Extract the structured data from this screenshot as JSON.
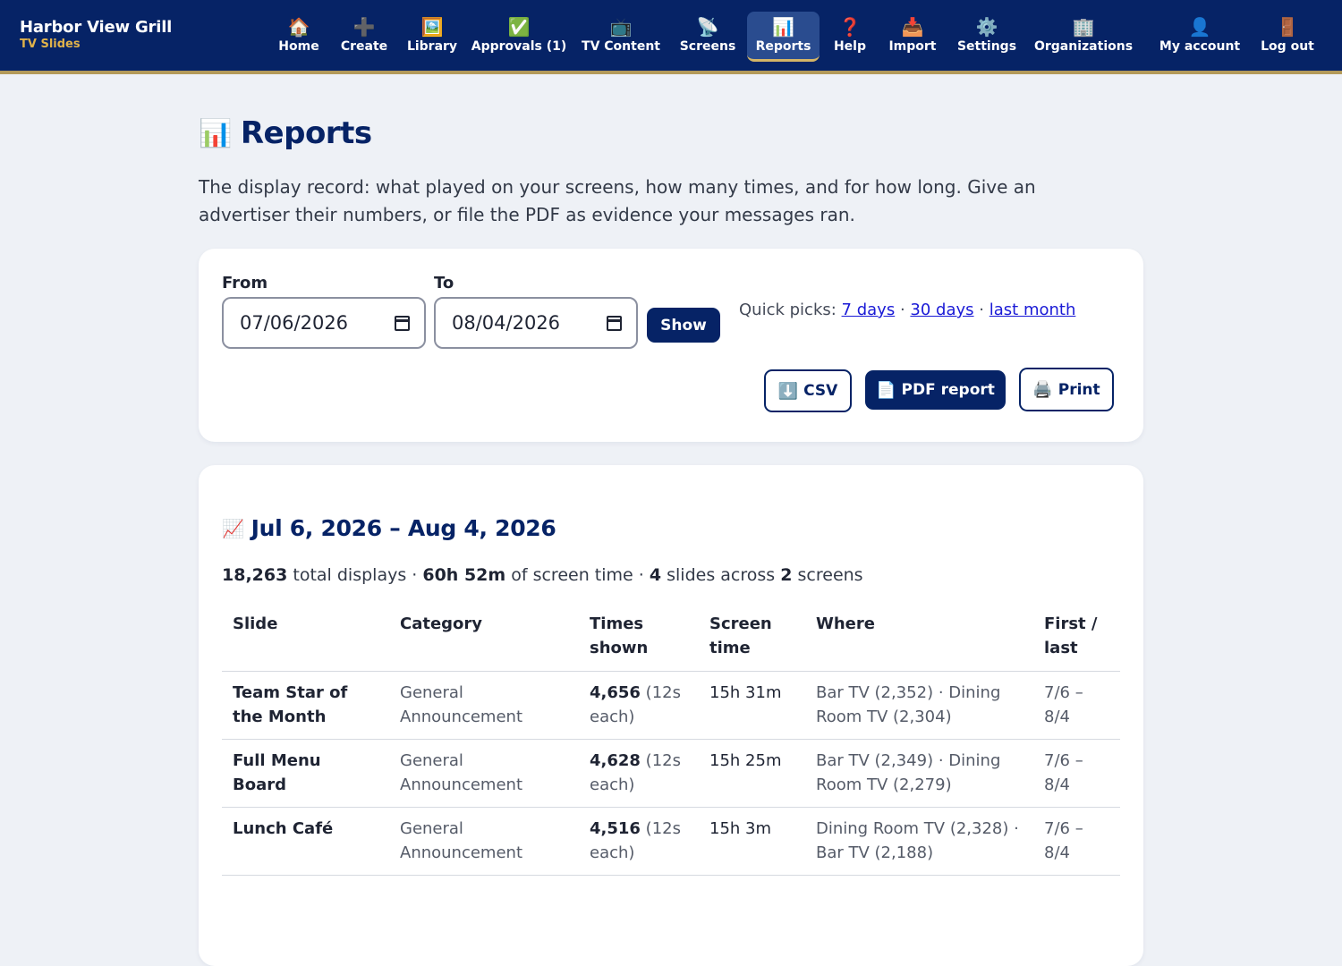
{
  "brand": {
    "title": "Harbor View Grill",
    "subtitle": "TV Slides"
  },
  "nav": [
    {
      "label": "Home",
      "icon": "🏠"
    },
    {
      "label": "Create",
      "icon": "➕"
    },
    {
      "label": "Library",
      "icon": "🖼️"
    },
    {
      "label": "Approvals (1)",
      "icon": "✅"
    },
    {
      "label": "TV Content",
      "icon": "📺"
    },
    {
      "label": "Screens",
      "icon": "📡"
    },
    {
      "label": "Reports",
      "icon": "📊"
    },
    {
      "label": "Help",
      "icon": "❓"
    },
    {
      "label": "Import",
      "icon": "📥"
    },
    {
      "label": "Settings",
      "icon": "⚙️"
    },
    {
      "label": "Organizations",
      "icon": "🏢"
    },
    {
      "label": "My account",
      "icon": "👤"
    },
    {
      "label": "Log out",
      "icon": "🚪"
    }
  ],
  "active_nav": "Reports",
  "page": {
    "title": "Reports",
    "title_icon": "📊",
    "intro": "The display record: what played on your screens, how many times, and for how long. Give an advertiser their numbers, or file the PDF as evidence your messages ran."
  },
  "filters": {
    "from_label": "From",
    "from_value": "07/06/2026",
    "to_label": "To",
    "to_value": "08/04/2026",
    "show_label": "Show",
    "quick_label": "Quick picks:",
    "quick_links": [
      "7 days",
      "30 days",
      "last month"
    ],
    "csv_label": "CSV",
    "csv_icon": "⬇️",
    "pdf_label": "PDF report",
    "pdf_icon": "📄",
    "print_label": "Print",
    "print_icon": "🖨️"
  },
  "results": {
    "range_title": "Jul 6, 2026 – Aug 4, 2026",
    "range_icon": "📈",
    "total_displays": "18,263",
    "total_displays_text": "total displays",
    "screen_time": "60h 52m",
    "screen_time_text": "of screen time",
    "slides_count": "4",
    "slides_text": "slides across",
    "screens_count": "2",
    "screens_text": "screens",
    "columns": [
      "Slide",
      "Category",
      "Times shown",
      "Screen time",
      "Where",
      "First / last"
    ],
    "rows": [
      {
        "slide": "Team Star of the Month",
        "category": "General Announcement",
        "times": "4,656",
        "each": "(12s each)",
        "screen_time": "15h 31m",
        "where": "Bar TV (2,352) · Dining Room TV (2,304)",
        "first_last": "7/6 – 8/4"
      },
      {
        "slide": "Full Menu Board",
        "category": "General Announcement",
        "times": "4,628",
        "each": "(12s each)",
        "screen_time": "15h 25m",
        "where": "Bar TV (2,349) · Dining Room TV (2,279)",
        "first_last": "7/6 – 8/4"
      },
      {
        "slide": "Lunch Café",
        "category": "General Announcement",
        "times": "4,516",
        "each": "(12s each)",
        "screen_time": "15h 3m",
        "where": "Dining Room TV (2,328) · Bar TV (2,188)",
        "first_last": "7/6 – 8/4"
      }
    ]
  }
}
